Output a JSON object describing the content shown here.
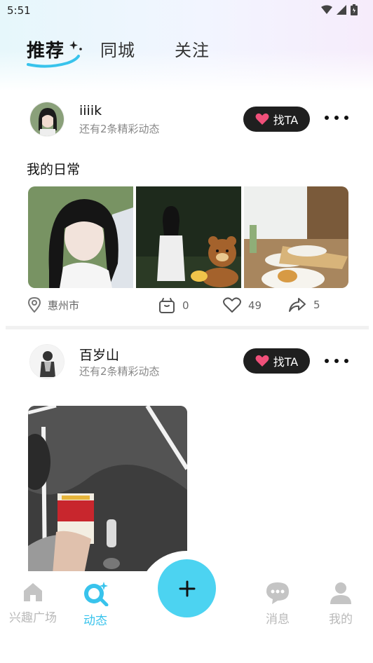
{
  "status_bar": {
    "time": "5:51"
  },
  "tabs": {
    "recommend": "推荐",
    "same_city": "同城",
    "follow": "关注"
  },
  "posts": [
    {
      "username": "iiiik",
      "subtitle": "还有2条精彩动态",
      "find_label": "找TA",
      "text": "我的日常",
      "location": "惠州市",
      "gift_count": "0",
      "like_count": "49",
      "share_count": "5"
    },
    {
      "username": "百岁山",
      "subtitle": "还有2条精彩动态",
      "find_label": "找TA"
    }
  ],
  "bottom_nav": {
    "items": [
      {
        "label": "兴趣广场",
        "icon": "home-icon"
      },
      {
        "label": "动态",
        "icon": "moments-icon"
      },
      {
        "label": "消息",
        "icon": "message-icon"
      },
      {
        "label": "我的",
        "icon": "profile-icon"
      }
    ],
    "add_icon": "plus-icon"
  },
  "colors": {
    "accent": "#38c3ec",
    "fab": "#4cd3f1",
    "find_button": "#1f1f1f",
    "heart": "#f0507a"
  }
}
